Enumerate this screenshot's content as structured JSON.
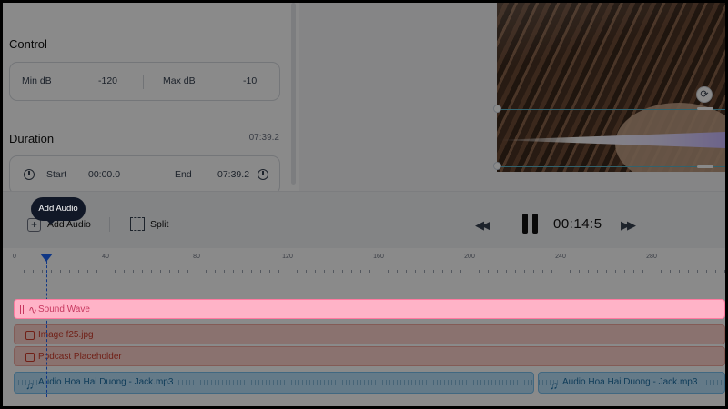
{
  "control": {
    "title": "Control",
    "min_db_label": "Min dB",
    "min_db_value": "-120",
    "max_db_label": "Max dB",
    "max_db_value": "-10"
  },
  "duration": {
    "title": "Duration",
    "total": "07:39.2",
    "start_label": "Start",
    "start_value": "00:00.0",
    "end_label": "End",
    "end_value": "07:39.2"
  },
  "toolbar": {
    "add_audio_label": "Add Audio",
    "split_label": "Split",
    "time": "00:14:5"
  },
  "tooltip": {
    "text": "Add Audio"
  },
  "ruler": {
    "labels": [
      "0",
      "40",
      "80",
      "120",
      "160",
      "200",
      "240",
      "280"
    ]
  },
  "tracks": {
    "sound_wave": "Sound Wave",
    "image": "Image f25.jpg",
    "podcast": "Podcast Placeholder",
    "audio_1": "Audio Hoa Hai Duong - Jack.mp3",
    "audio_2": "Audio Hoa Hai Duong - Jack.mp3"
  },
  "colors": {
    "accent": "#1e66f5",
    "sound_wave_track": "#ffb3c7",
    "image_track": "#ffd3cd",
    "audio_track": "#b9e1fb"
  },
  "icons": {
    "add": "plus-icon",
    "split": "split-icon",
    "rewind": "rewind-icon",
    "pause": "pause-icon",
    "forward": "fast-forward-icon",
    "clock": "clock-icon",
    "rotate": "rotate-icon",
    "wave": "waveform-icon",
    "image": "image-icon",
    "audio": "music-note-icon"
  }
}
